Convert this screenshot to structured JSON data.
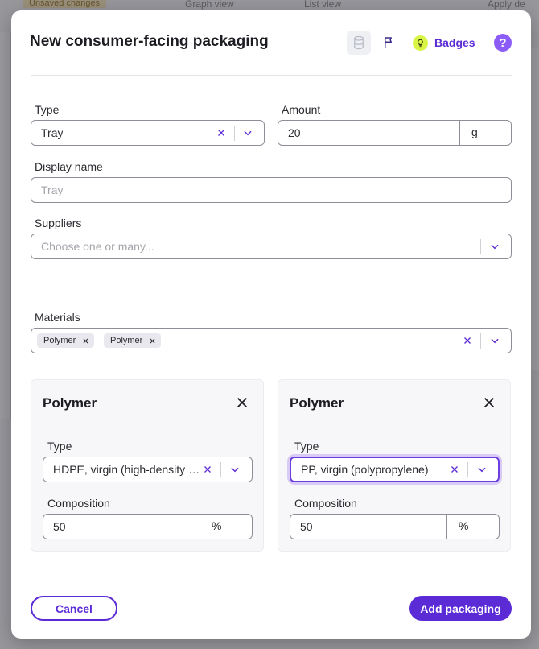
{
  "background": {
    "unsaved_label": "Unsaved changes",
    "graph_view_label": "Graph view",
    "list_view_label": "List view",
    "apply_label": "Apply de"
  },
  "modal": {
    "title": "New consumer-facing packaging",
    "badges_label": "Badges",
    "help_label": "?",
    "type": {
      "label": "Type",
      "value": "Tray"
    },
    "amount": {
      "label": "Amount",
      "value": "20",
      "unit": "g"
    },
    "display_name": {
      "label": "Display name",
      "placeholder": "Tray"
    },
    "suppliers": {
      "label": "Suppliers",
      "placeholder": "Choose one or many..."
    },
    "materials": {
      "label": "Materials",
      "chips": [
        "Polymer",
        "Polymer"
      ]
    },
    "cards": [
      {
        "title": "Polymer",
        "type_label": "Type",
        "type_value": "HDPE, virgin (high-density p...",
        "composition_label": "Composition",
        "composition_value": "50",
        "composition_unit": "%"
      },
      {
        "title": "Polymer",
        "type_label": "Type",
        "type_value": "PP, virgin (polypropylene)",
        "composition_label": "Composition",
        "composition_value": "50",
        "composition_unit": "%"
      }
    ],
    "cancel_label": "Cancel",
    "add_label": "Add packaging"
  },
  "colors": {
    "accent": "#5b2bd6",
    "accent_light": "#8b5cf6",
    "badge_bulb": "#d8f545",
    "border": "#8e8e96"
  }
}
